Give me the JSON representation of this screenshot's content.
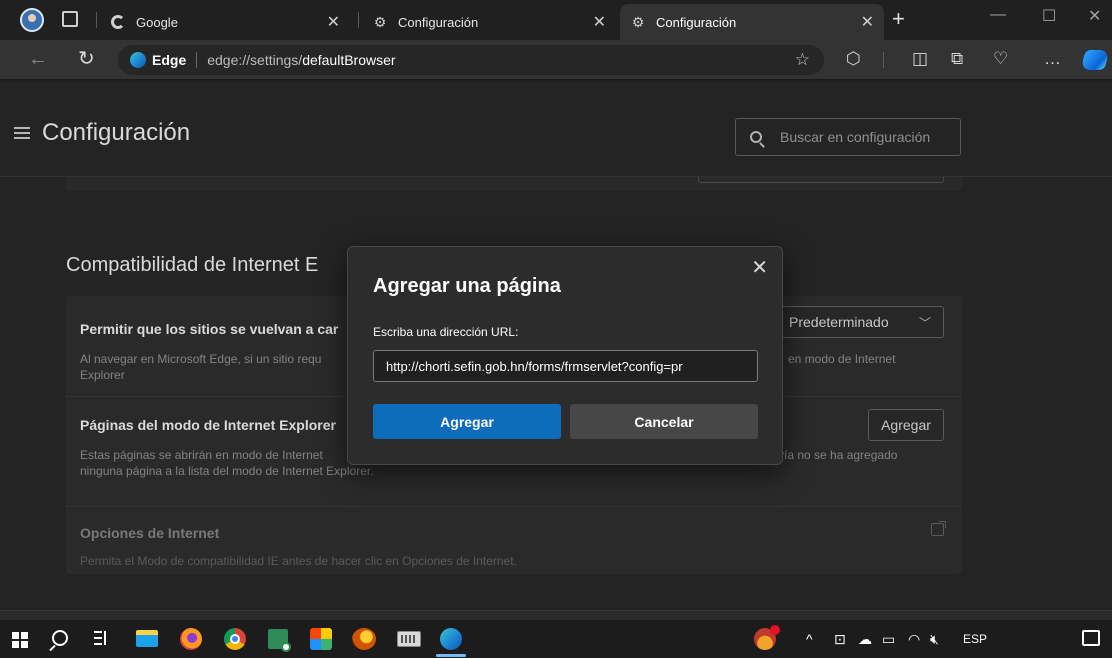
{
  "tabs": [
    {
      "label": "Google",
      "icon": "google-icon"
    },
    {
      "label": "Configuración",
      "icon": "gear-icon"
    },
    {
      "label": "Configuración",
      "icon": "gear-icon",
      "active": true
    }
  ],
  "address_bar": {
    "brand": "Edge",
    "url_host": "edge://settings/",
    "url_path": "defaultBrowser"
  },
  "settings": {
    "title": "Configuración",
    "search_placeholder": "Buscar en configuración",
    "section_title": "Compatibilidad de Internet E",
    "rows": [
      {
        "title": "Permitir que los sitios se vuelvan a car",
        "desc_left": "Al navegar en Microsoft Edge, si un sitio requ",
        "desc_left_2": "Explorer",
        "desc_right": "en modo de Internet",
        "control": "Predeterminado"
      },
      {
        "title": "Páginas del modo de Internet Explorer",
        "desc_left": "Estas páginas se abrirán en modo de Internet",
        "desc_right": "vía no se ha agregado",
        "desc_left_2": "ninguna página a la lista del modo de Internet Explorer.",
        "control": "Agregar"
      },
      {
        "title": "Opciones de Internet",
        "desc_left": "Permita el Modo de compatibilidad IE antes de hacer clic en Opciones de Internet."
      }
    ]
  },
  "dialog": {
    "title": "Agregar una página",
    "label": "Escriba una dirección URL:",
    "input_value": "http://chorti.sefin.gob.hn/forms/frmservlet?config=pr",
    "primary_button": "Agregar",
    "secondary_button": "Cancelar",
    "close_symbol": "✕"
  },
  "taskbar": {
    "language": "ESP",
    "apps": [
      "windows-start-icon",
      "search-icon",
      "task-view-icon",
      "file-explorer-icon",
      "firefox-icon",
      "chrome-icon",
      "app-icon",
      "app-icon",
      "app-icon",
      "keyboard-icon",
      "edge-icon"
    ]
  },
  "colors": {
    "accent": "#0f6cbd",
    "page_bg": "#2b2b2b",
    "card_bg": "#323232",
    "dialog_bg": "#2c2c2c"
  }
}
